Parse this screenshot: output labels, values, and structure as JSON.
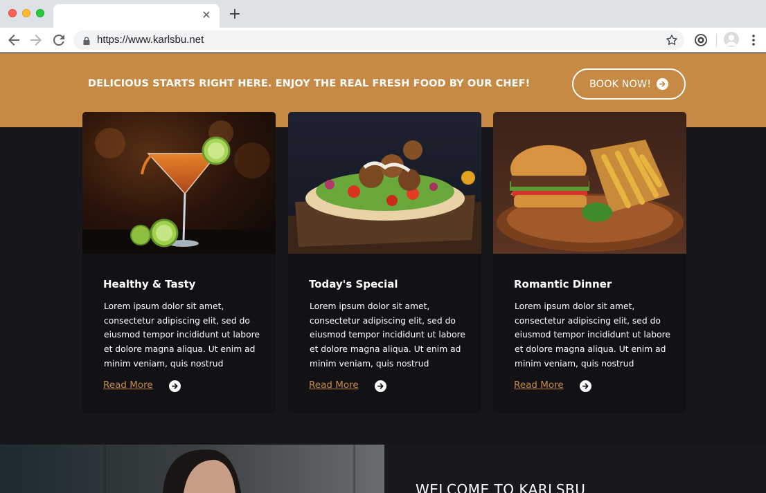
{
  "browser": {
    "url": "https://www.karlsbu.net",
    "icons": {
      "back": "arrow-left-icon",
      "forward": "arrow-right-icon",
      "reload": "reload-icon",
      "lock": "lock-icon",
      "bookmark": "star-icon",
      "extension": "extension-icon",
      "profile": "profile-icon",
      "menu": "kebab-menu-icon",
      "close_tab": "close-icon",
      "new_tab": "plus-icon"
    }
  },
  "promo": {
    "text": "DELICIOUS STARTS RIGHT HERE. ENJOY THE REAL FRESH FOOD BY OUR CHEF!",
    "button_label": "BOOK NOW!"
  },
  "cards": [
    {
      "title": "Healthy & Tasty",
      "body": "Lorem ipsum dolor sit amet, consectetur adipiscing elit, sed do eiusmod tempor incididunt ut labore et dolore magna aliqua. Ut enim ad minim veniam, quis nostrud",
      "link": "Read More",
      "image": "cocktail"
    },
    {
      "title": "Today's Special",
      "body": "Lorem ipsum dolor sit amet, consectetur adipiscing elit, sed do eiusmod tempor incididunt ut labore et dolore magna aliqua. Ut enim ad minim veniam, quis nostrud",
      "link": "Read More",
      "image": "falafel-wrap"
    },
    {
      "title": "Romantic Dinner",
      "body": "Lorem ipsum dolor sit amet, consectetur adipiscing elit, sed do eiusmod tempor incididunt ut labore et dolore magna aliqua. Ut enim ad minim veniam, quis nostrud",
      "link": "Read More",
      "image": "burger-and-fries"
    }
  ],
  "welcome": {
    "title": "WELCOME TO KARLSBU"
  },
  "colors": {
    "accent": "#c68a44",
    "background": "#16161b",
    "card": "#121216",
    "text": "#ffffff"
  }
}
